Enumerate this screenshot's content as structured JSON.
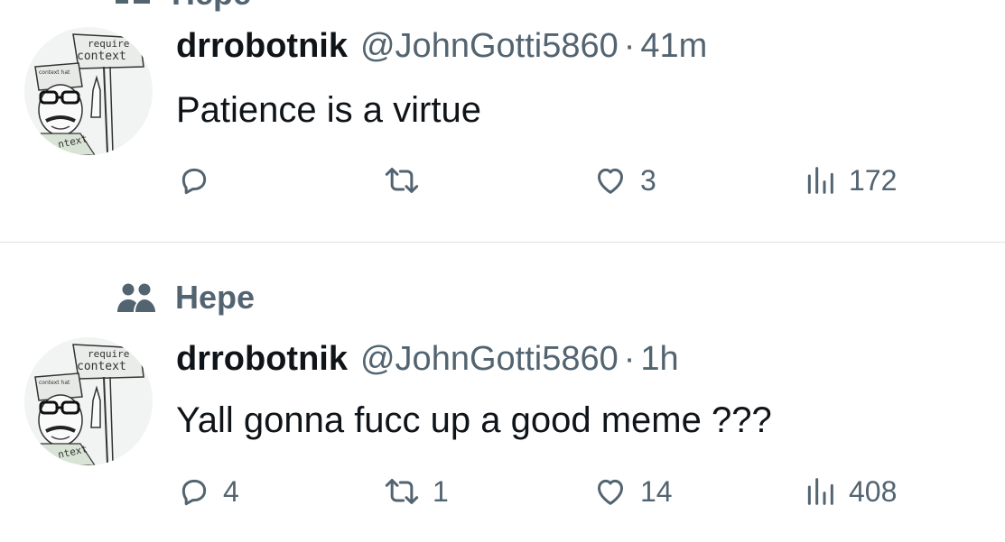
{
  "top_community": {
    "label": "Hepe"
  },
  "tweets": [
    {
      "community": "",
      "name": "drrobotnik",
      "handle": "@JohnGotti5860",
      "separator": "·",
      "time": "41m",
      "text": "Patience is a virtue",
      "replies": "",
      "retweets": "",
      "likes": "3",
      "views": "172"
    },
    {
      "community": "Hepe",
      "name": "drrobotnik",
      "handle": "@JohnGotti5860",
      "separator": "·",
      "time": "1h",
      "text": "Yall gonna fucc up a good meme ???",
      "replies": "4",
      "retweets": "1",
      "likes": "14",
      "views": "408"
    }
  ],
  "avatar": {
    "sign_text_1": "require",
    "sign_text_2": "context",
    "hat_text": "context hat",
    "shirt_text": "ntext"
  },
  "colors": {
    "text_primary": "#0f1419",
    "text_secondary": "#536471",
    "divider": "#dfe3e6"
  }
}
